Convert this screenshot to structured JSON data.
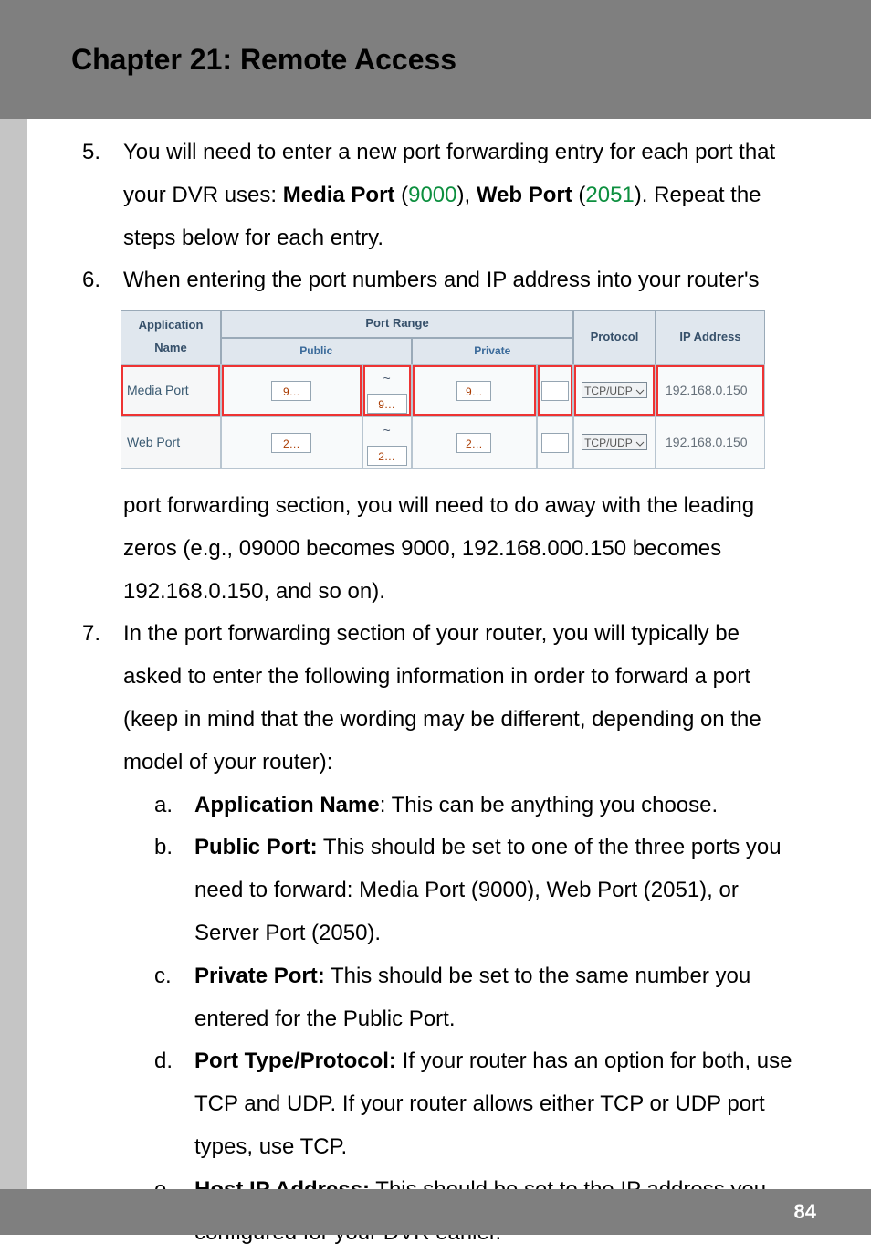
{
  "header": {
    "title": "Chapter 21: Remote Access"
  },
  "footer": {
    "page": "84"
  },
  "step5": {
    "num": "5.",
    "text_pre": "You will need to enter a new port forwarding entry for each port that your DVR uses: ",
    "media_label": "Media Port",
    "media_port": "9000",
    "mid1": "), ",
    "web_label": "Web Port",
    "web_port": "2051",
    "text_post": "). Repeat the steps below for each entry."
  },
  "step6": {
    "num": "6.",
    "text": "When entering the port numbers and IP address into your router's"
  },
  "table": {
    "h_app": "Application Name",
    "h_range": "Port Range",
    "h_proto": "Protocol",
    "h_ip": "IP Address",
    "h_pub": "Public",
    "h_priv": "Private",
    "rows": [
      {
        "app": "Media Port",
        "pub1": "9…",
        "pub_sep": "~",
        "pub2": "9…",
        "priv": "9…",
        "proto": "TCP/UDP",
        "ip": "192.168.0.150"
      },
      {
        "app": "Web Port",
        "pub1": "2…",
        "pub_sep": "~",
        "pub2": "2…",
        "priv": "2…",
        "proto": "TCP/UDP",
        "ip": "192.168.0.150"
      }
    ]
  },
  "step6b": {
    "text": "port forwarding section, you will need to do away with the leading zeros (e.g., 09000 becomes 9000, 192.168.000.150 becomes 192.168.0.150, and so on)."
  },
  "step7": {
    "num": "7.",
    "text": "In the port forwarding section of your router, you will typically be asked to enter the following information in order to forward a port (keep in mind that the wording may be different, depending on the model of your router):"
  },
  "sub": {
    "a": {
      "alpha": "a.",
      "bold": "Application Name",
      "text": ": This can be anything you choose."
    },
    "b": {
      "alpha": "b.",
      "bold": "Public Port:",
      "text": " This should be set to one of the three ports you need to forward: Media Port (9000), Web Port (2051), or Server Port (2050)."
    },
    "c": {
      "alpha": "c.",
      "bold": "Private Port:",
      "text": " This should be set to the same number you entered for the Public Port."
    },
    "d": {
      "alpha": "d.",
      "bold": "Port Type/Protocol:",
      "text": " If your router has an option for both, use TCP and UDP. If your router allows either TCP or UDP port types, use TCP."
    },
    "e": {
      "alpha": "e.",
      "bold": "Host IP Address:",
      "text": " This should be set to the IP address you configured for your DVR earlier."
    }
  }
}
